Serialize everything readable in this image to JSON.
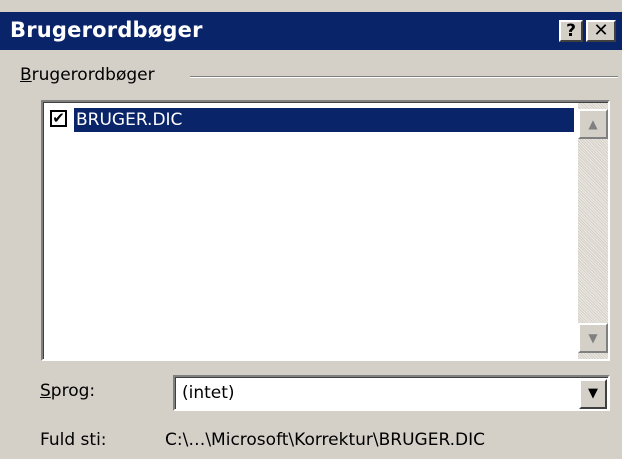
{
  "window": {
    "title": "Brugerordbøger",
    "help_glyph": "?",
    "close_glyph": "✕"
  },
  "group": {
    "label_first": "B",
    "label_rest": "rugerordbøger"
  },
  "dictionary_list": {
    "items": [
      {
        "label": "BRUGER.DIC",
        "checked": true,
        "selected": true
      }
    ],
    "check_glyph": "✔"
  },
  "scrollbar": {
    "up_glyph": "▲",
    "down_glyph": "▼"
  },
  "language": {
    "label_first": "S",
    "label_rest": "prog:",
    "value": "(intet)",
    "dropdown_glyph": "▼"
  },
  "full_path": {
    "label": "Fuld sti:",
    "value": "C:\\…\\Microsoft\\Korrektur\\BRUGER.DIC"
  },
  "colors": {
    "title_bar": "#0a246a",
    "dialog_face": "#d4d0c8",
    "selection": "#0a246a"
  }
}
